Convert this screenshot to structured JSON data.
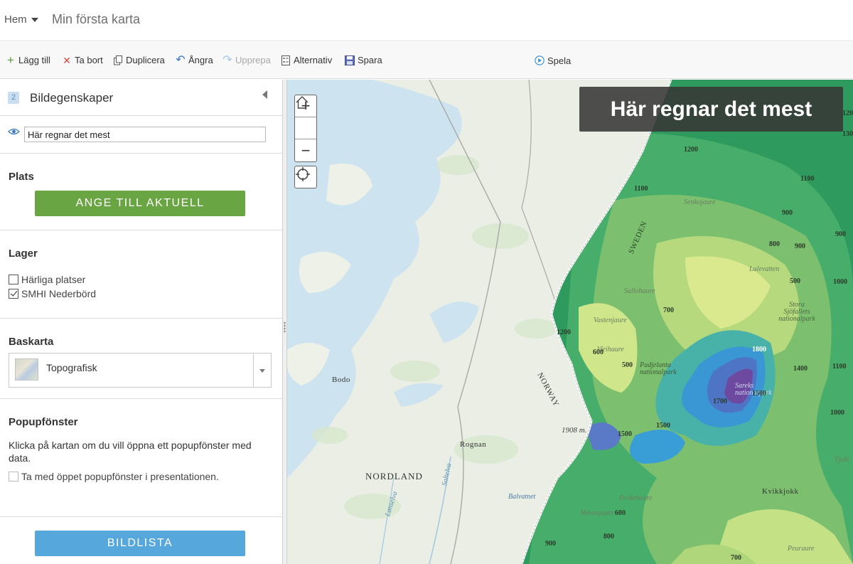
{
  "header": {
    "home_label": "Hem",
    "map_title": "Min första karta"
  },
  "toolbar": {
    "add": "Lägg till",
    "delete": "Ta bort",
    "duplicate": "Duplicera",
    "undo": "Ångra",
    "redo": "Upprepa",
    "options": "Alternativ",
    "save": "Spara",
    "play": "Spela"
  },
  "sidebar": {
    "slide_number": "2",
    "panel_title": "Bildegenskaper",
    "slide_title_value": "Här regnar det mest",
    "location": {
      "title": "Plats",
      "button": "ANGE TILL AKTUELL"
    },
    "layers": {
      "title": "Lager",
      "items": [
        {
          "label": "Härliga platser",
          "checked": false
        },
        {
          "label": "SMHI Nederbörd",
          "checked": true
        }
      ]
    },
    "basemap": {
      "title": "Baskarta",
      "selected": "Topografisk"
    },
    "popup": {
      "title": "Popupfönster",
      "text": "Klicka på kartan om du vill öppna ett popupfönster med data.",
      "checkbox_label": "Ta med öppet popupfönster i presentationen."
    },
    "slide_list_button": "BILDLISTA"
  },
  "map": {
    "slide_title": "Här regnar det mest",
    "labels": {
      "bodo": "Bodo",
      "rognan": "Rognan",
      "nordland": "NORDLAND",
      "norway": "NORWAY",
      "sweden": "SWEDEN",
      "peak": "1908 m.",
      "balvatnet": "Balvatnet",
      "kvikkjokk": "Kvikkjokk",
      "senkojaure": "Senkojaure",
      "lulevatten": "Lulevatten",
      "sallohaure": "Sallohaure",
      "vastenjaure": "Vastenjaure",
      "padjelanta": "Padjelanta nationalpark",
      "stora_sjofallet": "Stora Sjöfallets nationalpark",
      "sareks": "Sareks nationalpark",
      "peskehaure": "Peskehaure",
      "mavasjaure": "Mavasjaure",
      "peuraure": "Peuraure",
      "saltelva": "Saltelva",
      "lonselva": "Lønselva",
      "tjaktja": "Tjakt",
      "virihaure": "Virihaure"
    },
    "contours": {
      "c1200a": "1200",
      "c1100a": "1100",
      "c1100b": "1100",
      "c900a": "900",
      "c900b": "900",
      "c900c": "900",
      "c800a": "800",
      "c500a": "500",
      "c1000a": "1000",
      "c700a": "700",
      "c1200b": "1200",
      "c600a": "600",
      "c500b": "500",
      "c1800": "1800",
      "c1400": "1400",
      "c1500a": "1500",
      "c1700": "1700",
      "c1100c": "1100",
      "c1500b": "1500",
      "c1500c": "1500",
      "c1000b": "1000",
      "c600b": "600",
      "c800b": "800",
      "c900d": "900",
      "c700b": "700",
      "c1300": "130",
      "c1200c": "120"
    },
    "colors": {
      "precip_low": "#d9e88c",
      "precip_mid": "#5ab26b",
      "precip_high": "#3aa0c6",
      "precip_max": "#6d4aa0"
    }
  }
}
